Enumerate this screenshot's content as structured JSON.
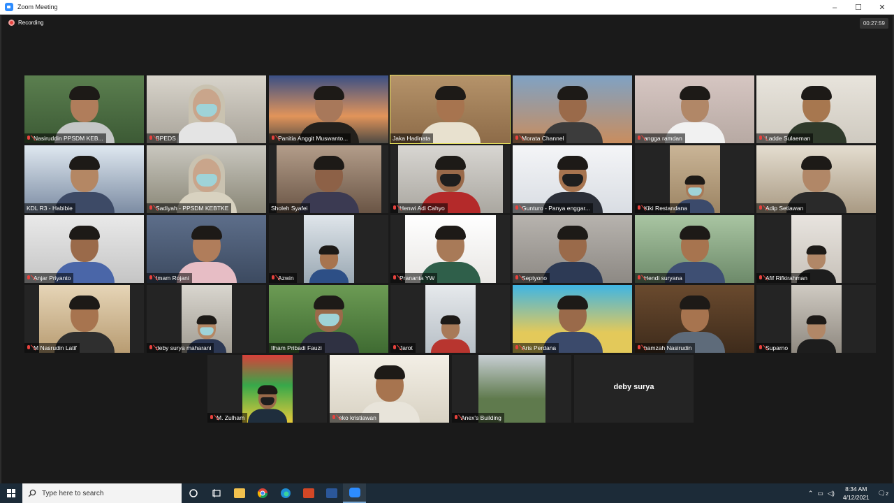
{
  "window": {
    "title": "Zoom Meeting"
  },
  "window_controls": {
    "minimize": "–",
    "maximize": "☐",
    "close": "✕"
  },
  "recording": {
    "label": "Recording"
  },
  "timer": "00:27:59",
  "participants": [
    {
      "name": "Nasiruddin PPSDM KEB...",
      "muted": true
    },
    {
      "name": "BPEDS",
      "muted": true
    },
    {
      "name": "Panitia Anggit Muswanto...",
      "muted": true
    },
    {
      "name": "Jaka Hadinata",
      "muted": false,
      "active": true
    },
    {
      "name": "Morata Channel",
      "muted": true
    },
    {
      "name": "angga ramdan",
      "muted": true
    },
    {
      "name": "Ladde Sulaeman",
      "muted": true
    },
    {
      "name": "KDL R3 - Habibie",
      "muted": false
    },
    {
      "name": "Sadiyah - PPSDM KEBTKE",
      "muted": true
    },
    {
      "name": "Sholeh Syafei",
      "muted": false
    },
    {
      "name": "Henwi Adi Cahyo",
      "muted": true
    },
    {
      "name": "Gunturo - Panya enggar...",
      "muted": true
    },
    {
      "name": "Kiki Restandana",
      "muted": true
    },
    {
      "name": "Adip Setiawan",
      "muted": true
    },
    {
      "name": "Anjar Priyanto",
      "muted": true
    },
    {
      "name": "Imam Rojani",
      "muted": true
    },
    {
      "name": "Azwin",
      "muted": true
    },
    {
      "name": "Prananta YW",
      "muted": true
    },
    {
      "name": "Septyono",
      "muted": true
    },
    {
      "name": "Hendi suryana",
      "muted": true
    },
    {
      "name": "Afif Rifkirahman",
      "muted": true
    },
    {
      "name": "M Nasrudin Latif",
      "muted": true
    },
    {
      "name": "deby surya maharani",
      "muted": true
    },
    {
      "name": "Ilham Pribadi Fauzi",
      "muted": false
    },
    {
      "name": "Jarot",
      "muted": true
    },
    {
      "name": "Aris Perdana",
      "muted": true
    },
    {
      "name": "hamzah Nasirudin",
      "muted": true
    },
    {
      "name": "Suparno",
      "muted": true
    },
    {
      "name": "M. Zulham",
      "muted": true
    },
    {
      "name": "eko kristiawan",
      "muted": true
    },
    {
      "name": "Anex's Building",
      "muted": true
    }
  ],
  "no_video_tile": {
    "name": "deby surya"
  },
  "taskbar": {
    "search_placeholder": "Type here to search",
    "time": "8:34 AM",
    "date": "4/12/2021",
    "notification_count": "2"
  },
  "colors": {
    "accent_active": "#e5e05a",
    "muted_mic": "#e8423d",
    "taskbar": "#1c2b38"
  }
}
